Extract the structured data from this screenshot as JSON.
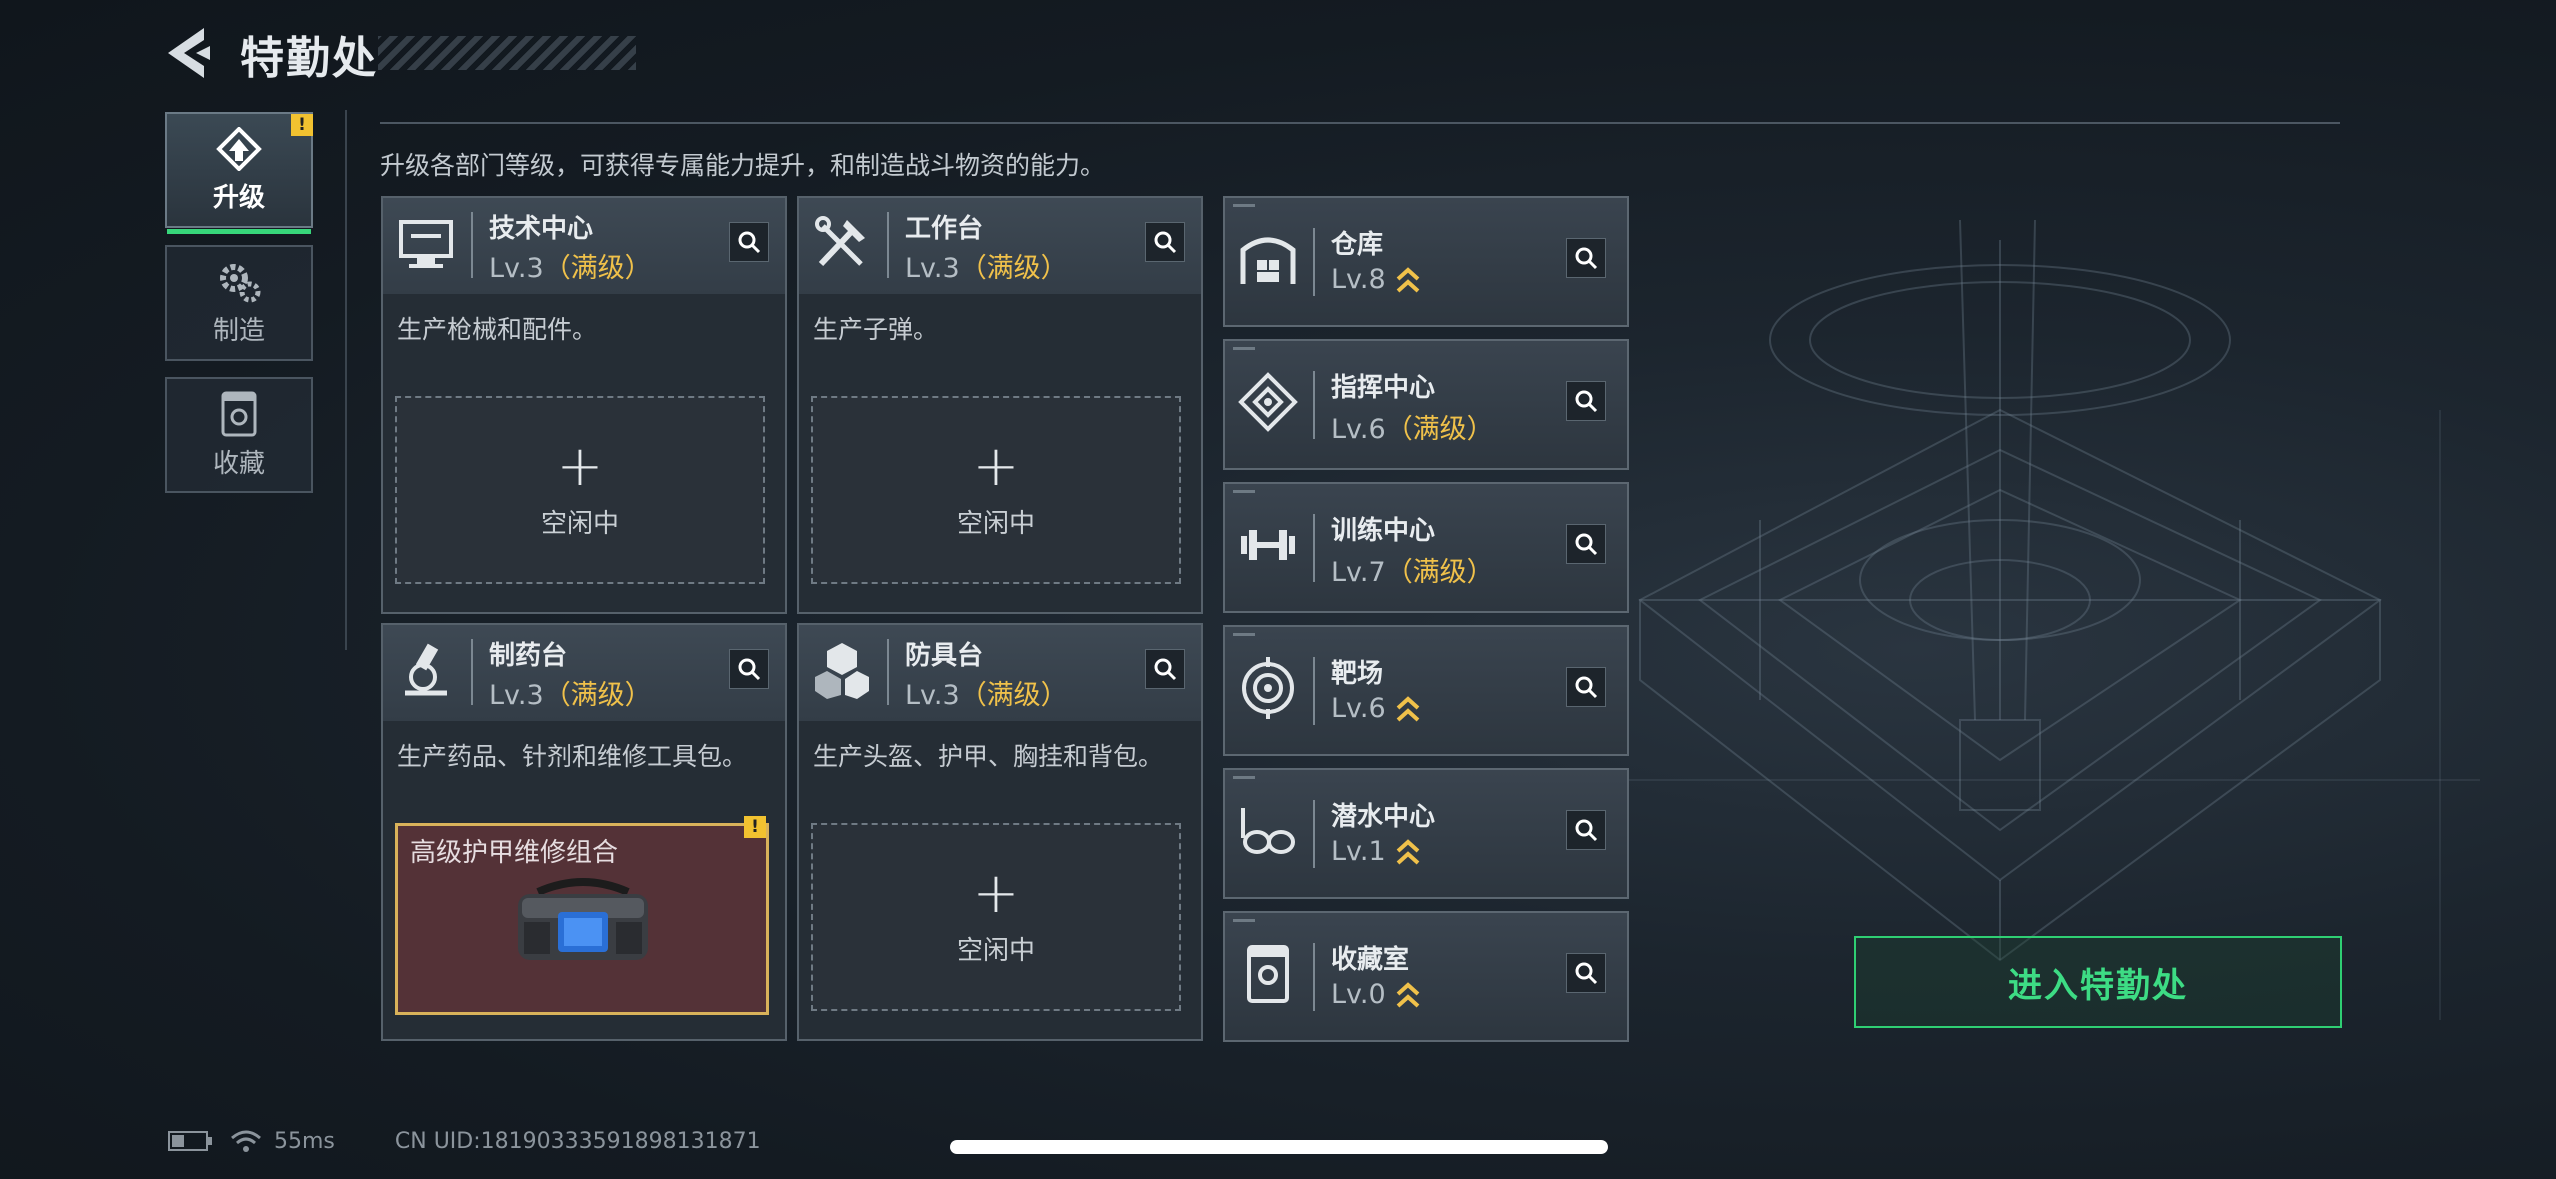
{
  "header": {
    "title": "特勤处"
  },
  "nav": [
    {
      "label": "升级",
      "icon": "upgrade-icon",
      "active": true,
      "alert": "!"
    },
    {
      "label": "制造",
      "icon": "gear-icon",
      "active": false
    },
    {
      "label": "收藏",
      "icon": "collection-icon",
      "active": false
    }
  ],
  "description": "升级各部门等级，可获得专属能力提升，和制造战斗物资的能力。",
  "departments": [
    {
      "name": "技术中心",
      "level": "Lv.3",
      "status": "（满级）",
      "desc": "生产枪械和配件。",
      "slot": "空闲中",
      "icon": "monitor-icon"
    },
    {
      "name": "工作台",
      "level": "Lv.3",
      "status": "（满级）",
      "desc": "生产子弹。",
      "slot": "空闲中",
      "icon": "tools-icon"
    },
    {
      "name": "制药台",
      "level": "Lv.3",
      "status": "（满级）",
      "desc": "生产药品、针剂和维修工具包。",
      "slot_item": "高级护甲维修组合",
      "slot_alert": "!",
      "icon": "microscope-icon"
    },
    {
      "name": "防具台",
      "level": "Lv.3",
      "status": "（满级）",
      "desc": "生产头盔、护甲、胸挂和背包。",
      "slot": "空闲中",
      "icon": "armor-blocks-icon"
    }
  ],
  "facilities": [
    {
      "name": "仓库",
      "level": "Lv.8",
      "status": "",
      "upgradable": true,
      "icon": "warehouse-icon"
    },
    {
      "name": "指挥中心",
      "level": "Lv.6",
      "status": "（满级）",
      "upgradable": false,
      "icon": "command-icon"
    },
    {
      "name": "训练中心",
      "level": "Lv.7",
      "status": "（满级）",
      "upgradable": false,
      "icon": "dumbbell-icon"
    },
    {
      "name": "靶场",
      "level": "Lv.6",
      "status": "",
      "upgradable": true,
      "icon": "target-icon"
    },
    {
      "name": "潜水中心",
      "level": "Lv.1",
      "status": "",
      "upgradable": true,
      "icon": "diving-mask-icon"
    },
    {
      "name": "收藏室",
      "level": "Lv.0",
      "status": "",
      "upgradable": true,
      "icon": "display-case-icon"
    }
  ],
  "enter_button": "进入特勤处",
  "footer": {
    "ping": "55ms",
    "uid": "CN UID:18190333591898131871"
  },
  "colors": {
    "accent_green": "#37d67a",
    "maxed_gold": "#f0c14a",
    "alert_yellow": "#f2c230"
  }
}
